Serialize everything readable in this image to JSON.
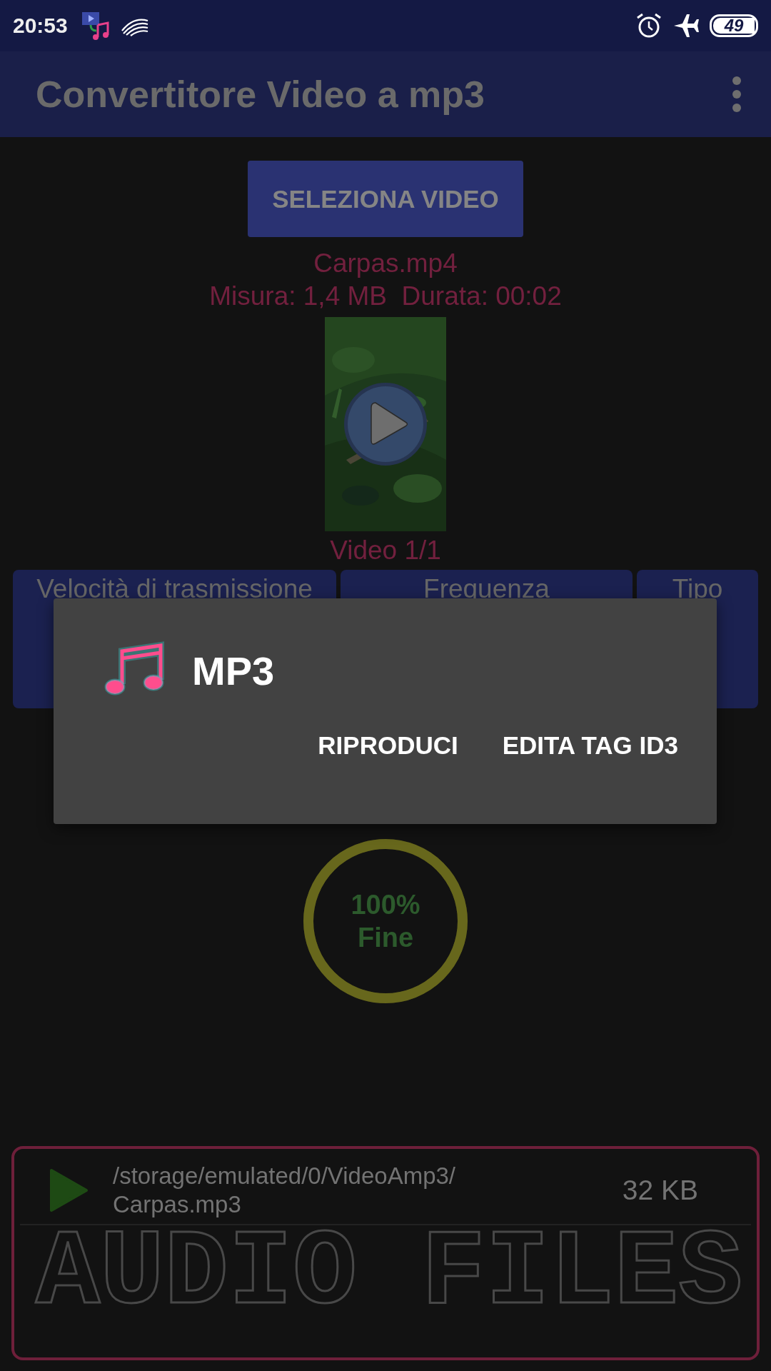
{
  "status_bar": {
    "time": "20:53",
    "battery": "49"
  },
  "app_bar": {
    "title": "Convertitore Video a mp3"
  },
  "select_button": "SELEZIONA VIDEO",
  "video": {
    "file_name": "Carpas.mp4",
    "info": "Misura: 1,4 MB  Durata: 00:02",
    "counter": "Video 1/1"
  },
  "options": [
    {
      "label": "Velocità di trasmissione"
    },
    {
      "label": "Frequenza"
    },
    {
      "label": "Tipo"
    }
  ],
  "progress": {
    "level": 1,
    "percent": "100%",
    "status": "Fine"
  },
  "audio_files": {
    "watermark": "AUDIO FILES",
    "files": [
      {
        "folder": "/storage/emulated/0/VideoAmp3/",
        "name": "Carpas.mp3",
        "size": "32 KB"
      }
    ]
  },
  "dialog": {
    "title": "MP3",
    "buttons": [
      "RIPRODUCI",
      "EDITA TAG ID3"
    ]
  }
}
